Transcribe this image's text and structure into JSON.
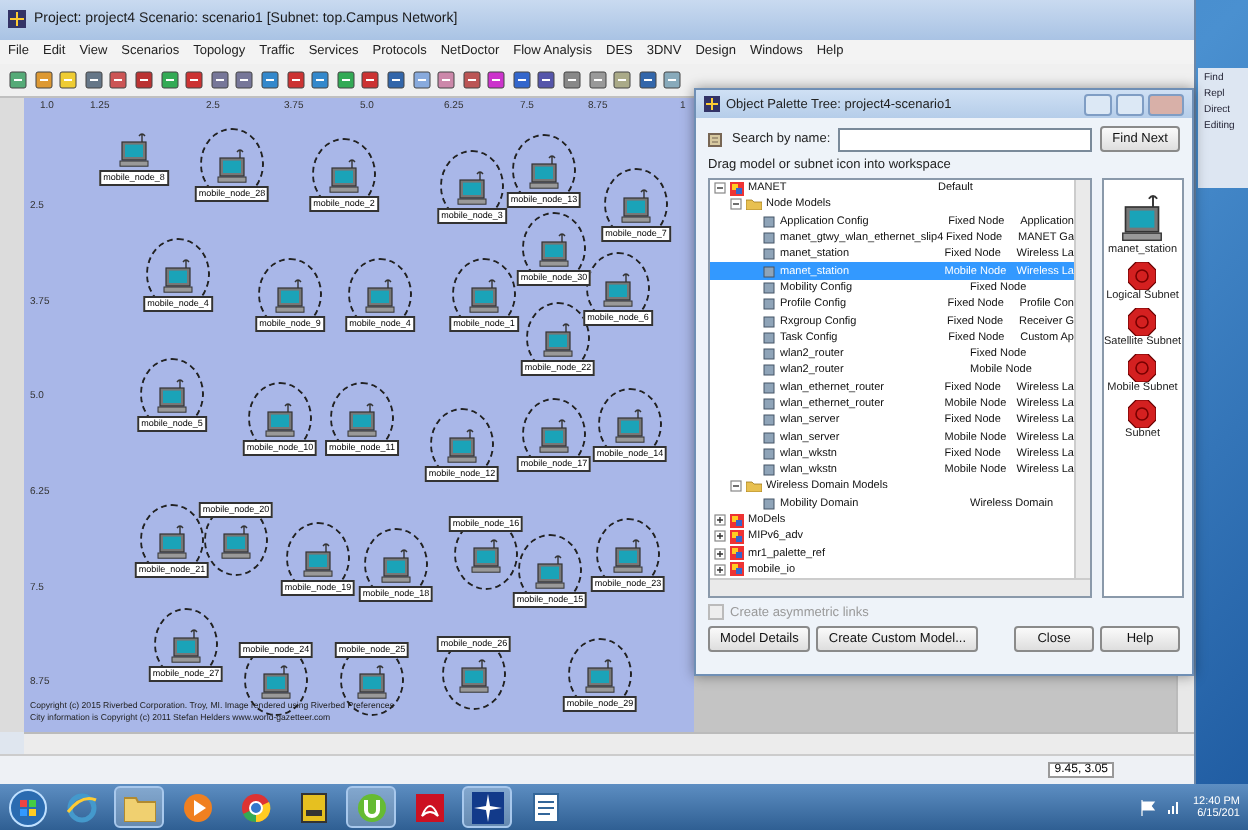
{
  "window": {
    "title": "Project: project4 Scenario: scenario1  [Subnet: top.Campus Network]"
  },
  "menu": [
    "File",
    "Edit",
    "View",
    "Scenarios",
    "Topology",
    "Traffic",
    "Services",
    "Protocols",
    "NetDoctor",
    "Flow Analysis",
    "DES",
    "3DNV",
    "Design",
    "Windows",
    "Help"
  ],
  "canvas": {
    "x_axis_labels": [
      "1.0",
      "1.25",
      "2.5",
      "3.75",
      "5.0",
      "6.25",
      "7.5",
      "8.75",
      "1"
    ],
    "y_axis_labels": [
      "2.5",
      "3.75",
      "5.0",
      "6.25",
      "7.5",
      "8.75"
    ],
    "nodes": [
      {
        "label": "mobile_node_8",
        "circled": false
      },
      {
        "label": "mobile_node_28",
        "circled": true
      },
      {
        "label": "mobile_node_2",
        "circled": true
      },
      {
        "label": "mobile_node_3",
        "circled": true
      },
      {
        "label": "mobile_node_13",
        "circled": true
      },
      {
        "label": "mobile_node_7",
        "circled": true
      },
      {
        "label": "mobile_node_30",
        "circled": true
      },
      {
        "label": "mobile_node_6",
        "circled": true
      },
      {
        "label": "mobile_node_4",
        "circled": true
      },
      {
        "label": "mobile_node_9",
        "circled": true
      },
      {
        "label": "mobile_node_4",
        "circled": true
      },
      {
        "label": "mobile_node_1",
        "circled": true
      },
      {
        "label": "mobile_node_22",
        "circled": true
      },
      {
        "label": "mobile_node_5",
        "circled": true
      },
      {
        "label": "mobile_node_10",
        "circled": true
      },
      {
        "label": "mobile_node_11",
        "circled": true
      },
      {
        "label": "mobile_node_12",
        "circled": true
      },
      {
        "label": "mobile_node_17",
        "circled": true
      },
      {
        "label": "mobile_node_14",
        "circled": true
      },
      {
        "label": "mobile_node_20",
        "circled": true
      },
      {
        "label": "mobile_node_21",
        "circled": true
      },
      {
        "label": "mobile_node_19",
        "circled": true
      },
      {
        "label": "mobile_node_18",
        "circled": true
      },
      {
        "label": "mobile_node_16",
        "circled": true
      },
      {
        "label": "mobile_node_15",
        "circled": true
      },
      {
        "label": "mobile_node_23",
        "circled": true
      },
      {
        "label": "mobile_node_27",
        "circled": true
      },
      {
        "label": "mobile_node_24",
        "circled": true
      },
      {
        "label": "mobile_node_25",
        "circled": true
      },
      {
        "label": "mobile_node_26",
        "circled": true
      },
      {
        "label": "mobile_node_29",
        "circled": true
      }
    ],
    "copyright": [
      "Copyright (c) 2015 Riverbed Corporation. Troy, MI. Image rendered using Riverbed Preferences",
      "City information is Copyright (c) 2011 Stefan Helders www.world-gazetteer.com"
    ]
  },
  "status_bar": {
    "coordinates": "9.45, 3.05"
  },
  "dialog": {
    "title": "Object Palette Tree: project4-scenario1",
    "search_label": "Search by name:",
    "find_button": "Find Next",
    "hint": "Drag model or subnet icon into workspace",
    "tree": [
      {
        "name": "MANET",
        "type": "Default",
        "expanded": true,
        "selected": false,
        "children": [
          {
            "name": "Node Models",
            "expanded": true,
            "selected": false,
            "children": [
              {
                "name": "Application Config",
                "type": "Fixed Node",
                "description": "Application",
                "selected": false
              },
              {
                "name": "manet_gtwy_wlan_ethernet_slip4",
                "type": "Fixed Node",
                "description": "MANET Ga",
                "selected": false
              },
              {
                "name": "manet_station",
                "type": "Fixed Node",
                "description": "Wireless La",
                "selected": false
              },
              {
                "name": "manet_station",
                "type": "Mobile Node",
                "description": "Wireless La",
                "selected": true
              },
              {
                "name": "Mobility Config",
                "type": "Fixed Node",
                "selected": false
              },
              {
                "name": "Profile Config",
                "type": "Fixed Node",
                "description": "Profile Con",
                "selected": false
              },
              {
                "name": "Rxgroup Config",
                "type": "Fixed Node",
                "description": "Receiver G",
                "selected": false
              },
              {
                "name": "Task Config",
                "type": "Fixed Node",
                "description": "Custom Ap",
                "selected": false
              },
              {
                "name": "wlan2_router",
                "type": "Fixed Node",
                "selected": false
              },
              {
                "name": "wlan2_router",
                "type": "Mobile Node",
                "selected": false
              },
              {
                "name": "wlan_ethernet_router",
                "type": "Fixed Node",
                "description": "Wireless La",
                "selected": false
              },
              {
                "name": "wlan_ethernet_router",
                "type": "Mobile Node",
                "description": "Wireless La",
                "selected": false
              },
              {
                "name": "wlan_server",
                "type": "Fixed Node",
                "description": "Wireless La",
                "selected": false
              },
              {
                "name": "wlan_server",
                "type": "Mobile Node",
                "description": "Wireless La",
                "selected": false
              },
              {
                "name": "wlan_wkstn",
                "type": "Fixed Node",
                "description": "Wireless La",
                "selected": false
              },
              {
                "name": "wlan_wkstn",
                "type": "Mobile Node",
                "description": "Wireless La",
                "selected": false
              }
            ]
          },
          {
            "name": "Wireless Domain Models",
            "expanded": true,
            "selected": false,
            "children": [
              {
                "name": "Mobility Domain",
                "type": "Wireless Domain",
                "selected": false
              }
            ]
          }
        ]
      },
      {
        "name": "MoDels",
        "expanded": false,
        "selected": false
      },
      {
        "name": "MIPv6_adv",
        "expanded": false,
        "selected": false
      },
      {
        "name": "mr1_palette_ref",
        "expanded": false,
        "selected": false
      },
      {
        "name": "mobile_io",
        "expanded": false,
        "selected": false
      }
    ],
    "palette": [
      {
        "label": "manet_station",
        "kind": "station"
      },
      {
        "label": "Logical Subnet",
        "kind": "subnet"
      },
      {
        "label": "Satellite Subnet",
        "kind": "subnet"
      },
      {
        "label": "Mobile Subnet",
        "kind": "subnet"
      },
      {
        "label": "Subnet",
        "kind": "subnet"
      }
    ],
    "checkbox": {
      "label": "Create asymmetric links",
      "checked": false,
      "disabled": true
    },
    "buttons": [
      "Model Details",
      "Create Custom Model...",
      "Close",
      "Help"
    ]
  },
  "back_window": {
    "items": [
      "Find",
      "Repl",
      "Direct",
      "Editing"
    ]
  },
  "taskbar": {
    "apps": [
      {
        "kind": "ie",
        "selected": false
      },
      {
        "kind": "folder",
        "selected": true
      },
      {
        "kind": "media",
        "selected": false
      },
      {
        "kind": "chrome",
        "selected": false
      },
      {
        "kind": "books",
        "selected": false
      },
      {
        "kind": "torrent",
        "selected": true
      },
      {
        "kind": "pdf",
        "selected": false
      },
      {
        "kind": "star",
        "selected": true
      },
      {
        "kind": "doc",
        "selected": false
      }
    ],
    "clock": {
      "time": "12:40 PM",
      "date": "6/15/201"
    }
  }
}
